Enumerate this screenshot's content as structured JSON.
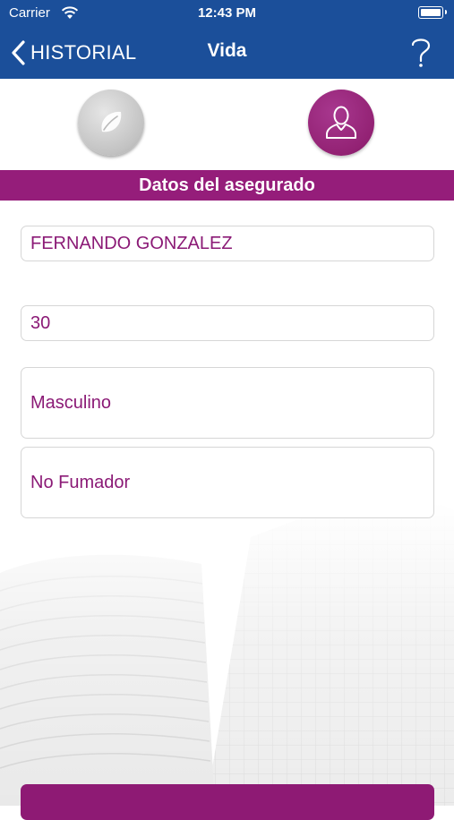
{
  "status_bar": {
    "carrier": "Carrier",
    "time": "12:43 PM"
  },
  "nav": {
    "back_label": "HISTORIAL",
    "title": "Vida"
  },
  "steps": {
    "active": "insured"
  },
  "section": {
    "title": "Datos del asegurado"
  },
  "form": {
    "name": "FERNANDO GONZALEZ",
    "age": "30",
    "sex": "Masculino",
    "smoker": "No Fumador"
  },
  "colors": {
    "nav_blue": "#1b4f9a",
    "accent_purple": "#951d7a",
    "field_text": "#8b1a76",
    "inactive_step": "#c2c2c2"
  },
  "icons": {
    "back": "chevron-left-icon",
    "help": "question-mark-icon",
    "step_policy": "leaf-icon",
    "step_insured": "person-icon"
  }
}
